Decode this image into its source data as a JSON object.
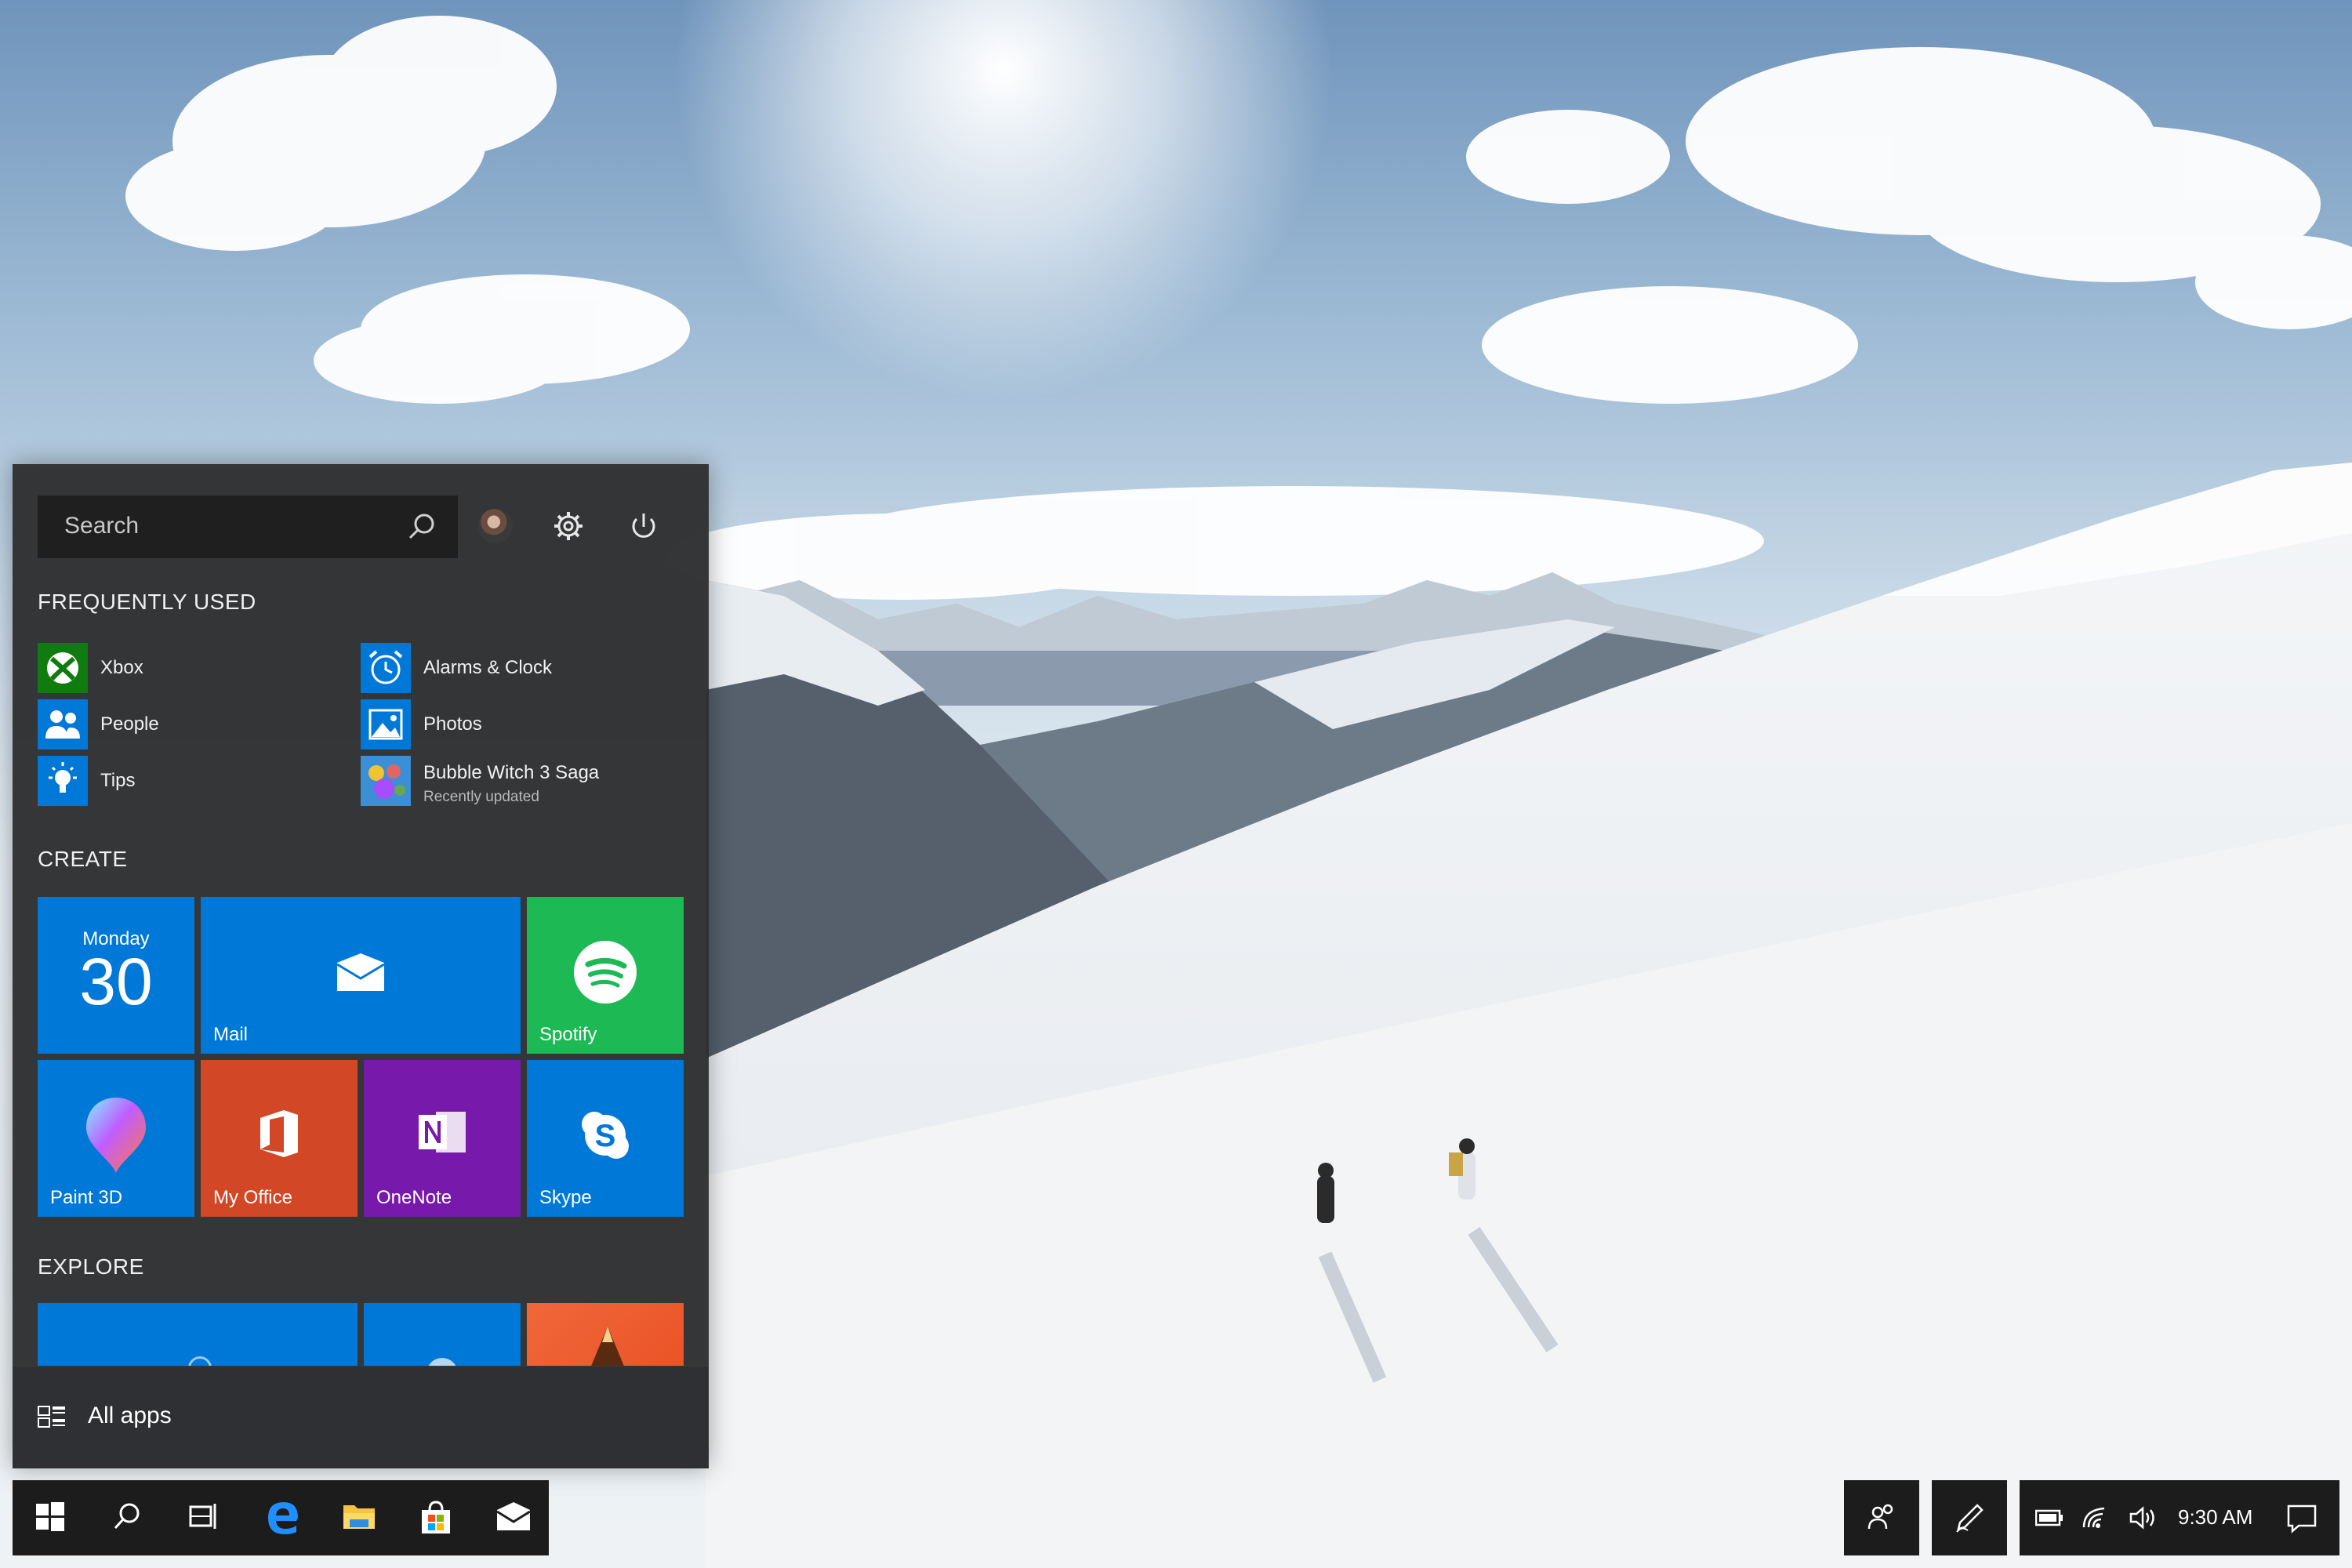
{
  "start_menu": {
    "search": {
      "placeholder": "Search",
      "icon": "search-icon"
    },
    "top_icons": [
      "avatar",
      "gear-icon",
      "power-icon"
    ],
    "sections": {
      "frequently_used": "FREQUENTLY USED",
      "create": "CREATE",
      "explore": "EXPLORE"
    },
    "frequent_apps": [
      {
        "label": "Xbox",
        "icon": "xbox-icon",
        "color": "#107c10"
      },
      {
        "label": "People",
        "icon": "people-icon",
        "color": "#0078d7"
      },
      {
        "label": "Tips",
        "icon": "lightbulb-icon",
        "color": "#0078d7"
      },
      {
        "label": "Alarms & Clock",
        "icon": "alarm-clock-icon",
        "color": "#0078d7"
      },
      {
        "label": "Photos",
        "icon": "photos-icon",
        "color": "#0078d7"
      },
      {
        "label": "Bubble Witch 3 Saga",
        "sublabel": "Recently updated",
        "icon": "bubble-witch-icon",
        "color": "#3a8fd6"
      }
    ],
    "tiles": {
      "calendar": {
        "day": "Monday",
        "date": "30",
        "color": "#0078d7"
      },
      "mail": {
        "label": "Mail",
        "icon": "mail-icon",
        "color": "#0078d7"
      },
      "spotify": {
        "label": "Spotify",
        "icon": "spotify-icon",
        "color": "#1db954"
      },
      "paint3d": {
        "label": "Paint 3D",
        "icon": "paint3d-icon",
        "color": "#0078d7"
      },
      "my_office": {
        "label": "My Office",
        "icon": "office-icon",
        "color": "#d24726"
      },
      "onenote": {
        "label": "OneNote",
        "icon": "onenote-icon",
        "color": "#7719aa"
      },
      "skype": {
        "label": "Skype",
        "icon": "skype-icon",
        "color": "#0078d7"
      }
    },
    "all_apps": {
      "label": "All apps",
      "icon": "all-apps-icon"
    }
  },
  "taskbar": {
    "buttons": [
      "windows-start-icon",
      "search-icon",
      "task-view-icon",
      "edge-icon",
      "file-explorer-icon",
      "store-icon",
      "mail-icon"
    ],
    "tray": {
      "people": "people-icon",
      "pen": "pen-workspace-icon",
      "status_icons": [
        "battery-icon",
        "wifi-icon",
        "volume-icon"
      ],
      "time": "9:30 AM",
      "notifications": "action-center-icon"
    }
  }
}
